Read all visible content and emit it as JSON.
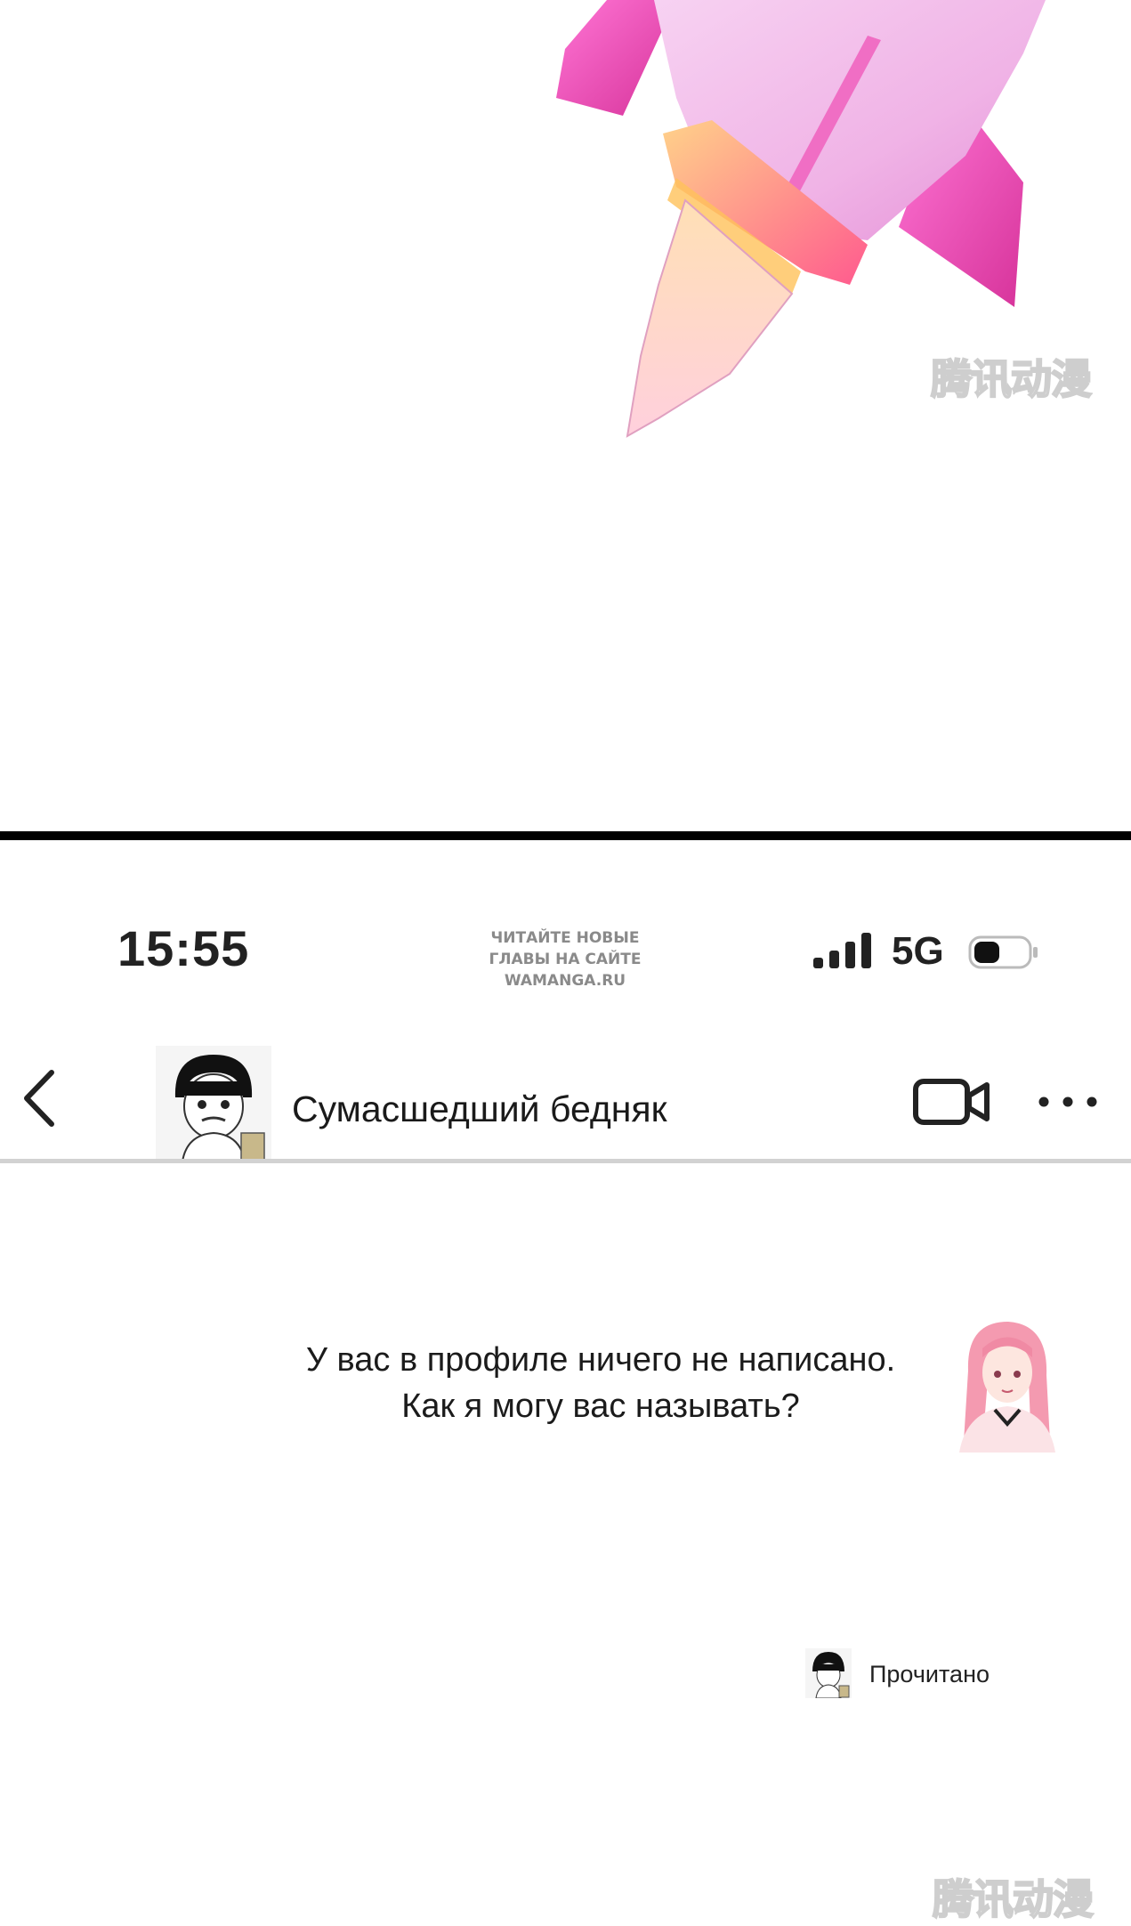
{
  "status_bar": {
    "time": "15:55",
    "site_note": [
      "Читайте новые",
      "главы на сайте",
      "wamanga.ru"
    ],
    "network": "5G"
  },
  "chat_header": {
    "contact_name": "Сумасшедший бедняк"
  },
  "messages": [
    {
      "lines": [
        "У вас в профиле ничего не написано.",
        "Как я могу вас называть?"
      ]
    }
  ],
  "read_receipt": "Прочитано",
  "watermark": "腾讯动漫",
  "colors": {
    "divider": "#000000",
    "rocket_body": "#f4c9ec",
    "rocket_fin": "#e03aa8",
    "header_rule": "#d2d2d2"
  },
  "icons": [
    "chevron-left-icon",
    "video-camera-icon",
    "more-dots-icon",
    "signal-bars-icon",
    "battery-icon"
  ]
}
